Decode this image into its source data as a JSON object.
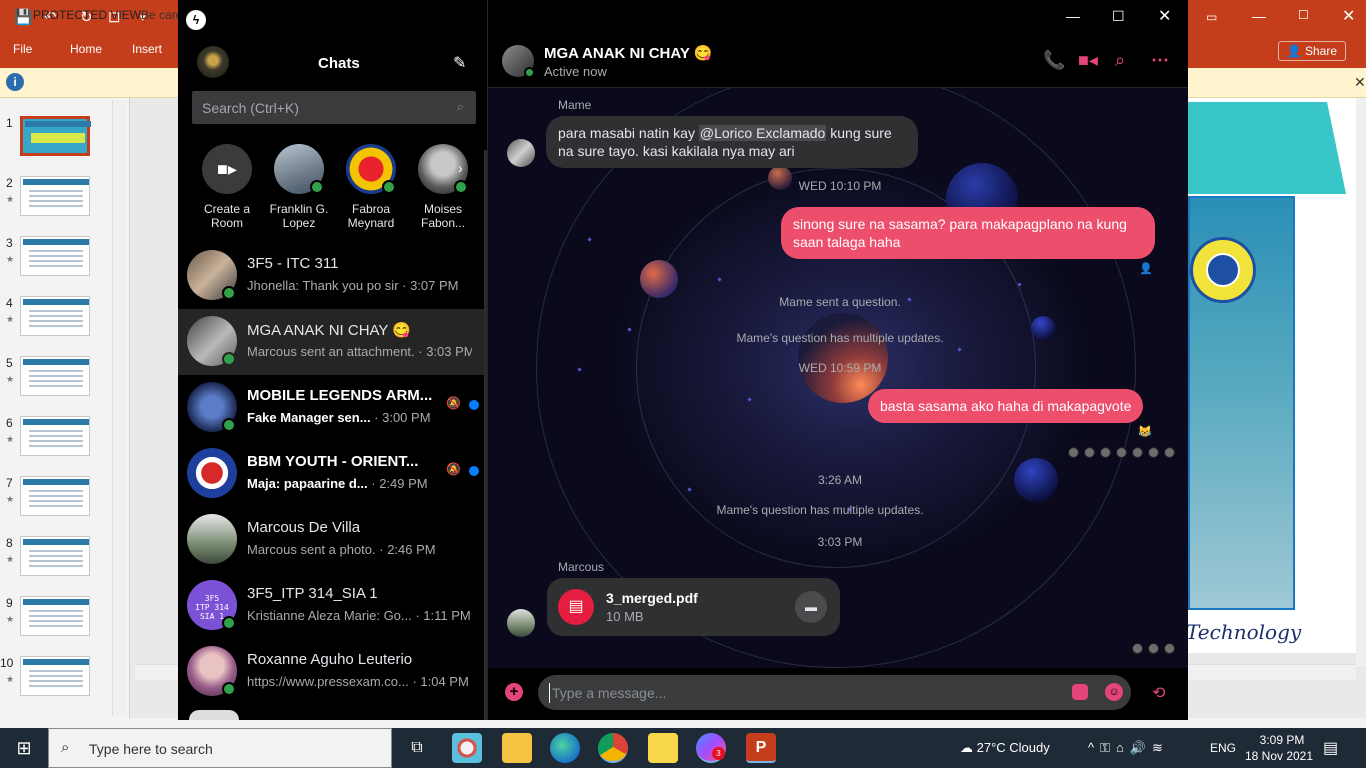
{
  "powerpoint": {
    "tabs": [
      "File",
      "Home",
      "Insert"
    ],
    "share_label": "Share",
    "protected_label": "PROTECTED VIEW",
    "protected_sub": "Be care",
    "slide_numbers": [
      "1",
      "2",
      "3",
      "4",
      "5",
      "6",
      "7",
      "8",
      "9",
      "10"
    ],
    "slide_text": "Technology"
  },
  "messenger": {
    "title": "Chats",
    "search_placeholder": "Search (Ctrl+K)",
    "stories": [
      {
        "label": "Create a Room"
      },
      {
        "label": "Franklin G. Lopez"
      },
      {
        "label": "Fabroa Meynard"
      },
      {
        "label": "Moises Fabon..."
      }
    ],
    "chats": [
      {
        "name": "3F5 - ITC 311",
        "preview": "Jhonella: Thank you po sir",
        "time": " · 3:07 PM"
      },
      {
        "name": "MGA ANAK NI CHAY 😋",
        "preview": "Marcous sent an attachment.",
        "time": " · 3:03 PM"
      },
      {
        "name": "MOBILE LEGENDS ARM...",
        "preview": "Fake Manager sen...",
        "time": " · 3:00 PM"
      },
      {
        "name": "BBM YOUTH - ORIENT...",
        "preview": "Maja: papaarine d...",
        "time": " · 2:49 PM"
      },
      {
        "name": "Marcous De Villa",
        "preview": "Marcous sent a photo.",
        "time": " · 2:46 PM"
      },
      {
        "name": "3F5_ITP 314_SIA 1",
        "preview": "Kristianne Aleza Marie: Go...",
        "time": " · 1:11 PM"
      },
      {
        "name": "Roxanne Aguho Leuterio",
        "preview": "https://www.pressexam.co...",
        "time": " · 1:04 PM"
      }
    ],
    "conversation": {
      "title": "MGA ANAK NI CHAY 😋",
      "status": "Active now",
      "messages": {
        "sender_mame": "Mame",
        "msg1_pre": "para masabi natin kay ",
        "msg1_mention": "@Lorico Exclamado",
        "msg1_post": " kung sure na sure tayo. kasi kakilala nya may ari",
        "ts1": "WED 10:10 PM",
        "msg2": "sinong sure na sasama? para makapagplano na kung saan talaga haha",
        "sys1": "Mame sent a question.",
        "sys2": "Mame's question has multiple updates.",
        "ts2": "WED 10:59 PM",
        "msg3": "basta sasama ako haha di makapagvote",
        "ts3": "3:26 AM",
        "sys3": "Mame's question has multiple updates.",
        "ts4": "3:03 PM",
        "sender_marcous": "Marcous",
        "file_name": "3_merged.pdf",
        "file_size": "10 MB"
      },
      "composer_placeholder": "Type a message..."
    },
    "accent_color": "#e4447c",
    "outgoing_bubble_color": "#ec4e6b"
  },
  "taskbar": {
    "search_text": "Type here to search",
    "weather": "27°C  Cloudy",
    "language": "ENG",
    "time": "3:09 PM",
    "date": "18 Nov 2021",
    "messenger_badge": "3"
  }
}
